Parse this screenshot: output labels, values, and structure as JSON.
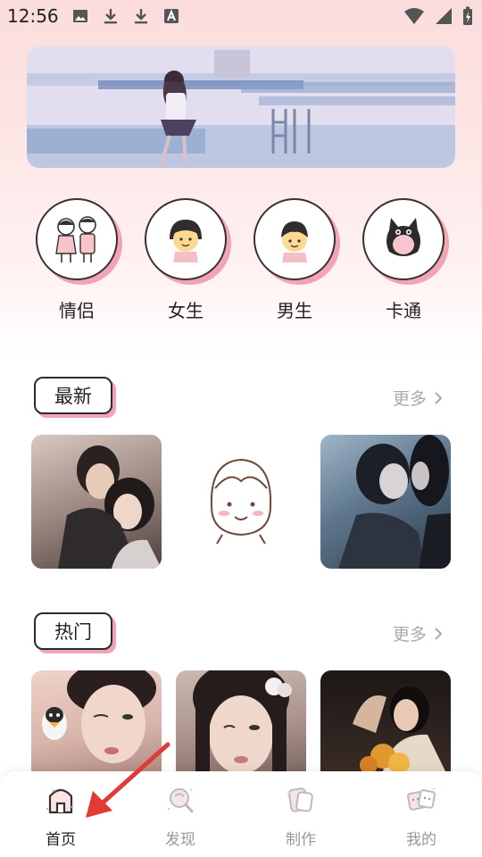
{
  "status_bar": {
    "time": "12:56"
  },
  "categories": [
    {
      "label": "情侣",
      "icon": "couple-avatar-icon"
    },
    {
      "label": "女生",
      "icon": "girl-avatar-icon"
    },
    {
      "label": "男生",
      "icon": "boy-avatar-icon"
    },
    {
      "label": "卡通",
      "icon": "cartoon-cat-avatar-icon"
    }
  ],
  "sections": {
    "latest": {
      "title": "最新",
      "more": "更多"
    },
    "hot": {
      "title": "热门",
      "more": "更多"
    }
  },
  "bottom_nav": [
    {
      "label": "首页",
      "icon": "home-icon",
      "active": true
    },
    {
      "label": "发现",
      "icon": "discover-icon",
      "active": false
    },
    {
      "label": "制作",
      "icon": "create-icon",
      "active": false
    },
    {
      "label": "我的",
      "icon": "profile-icon",
      "active": false
    }
  ],
  "colors": {
    "accent_pink": "#f0a4b4",
    "arrow_red": "#e23a36"
  }
}
